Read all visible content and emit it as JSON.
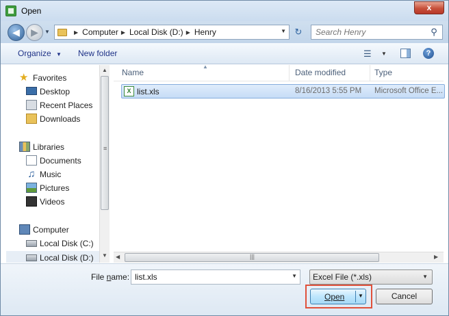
{
  "window": {
    "title": "Open",
    "close_symbol": "x"
  },
  "address": {
    "breadcrumbs": [
      "Computer",
      "Local Disk (D:)",
      "Henry"
    ],
    "search_placeholder": "Search Henry"
  },
  "toolbar": {
    "organize_label": "Organize",
    "new_folder_label": "New folder"
  },
  "navigation": {
    "favorites": {
      "label": "Favorites",
      "items": [
        "Desktop",
        "Recent Places",
        "Downloads"
      ]
    },
    "libraries": {
      "label": "Libraries",
      "items": [
        "Documents",
        "Music",
        "Pictures",
        "Videos"
      ]
    },
    "computer": {
      "label": "Computer",
      "items": [
        "Local Disk (C:)",
        "Local Disk (D:)"
      ],
      "selected": "Local Disk (D:)"
    }
  },
  "columns": {
    "name": "Name",
    "date": "Date modified",
    "type": "Type"
  },
  "files": [
    {
      "name": "list.xls",
      "date": "8/16/2013 5:55 PM",
      "type": "Microsoft Office E...",
      "selected": true
    }
  ],
  "bottom": {
    "file_name_label_pre": "File ",
    "file_name_label_accel": "n",
    "file_name_label_post": "ame:",
    "file_name_value": "list.xls",
    "file_type_filter": "Excel File (*.xls)",
    "open_label": "Open",
    "cancel_label": "Cancel"
  },
  "colors": {
    "highlight": "#e0503a",
    "accent": "#3c7fb1"
  }
}
